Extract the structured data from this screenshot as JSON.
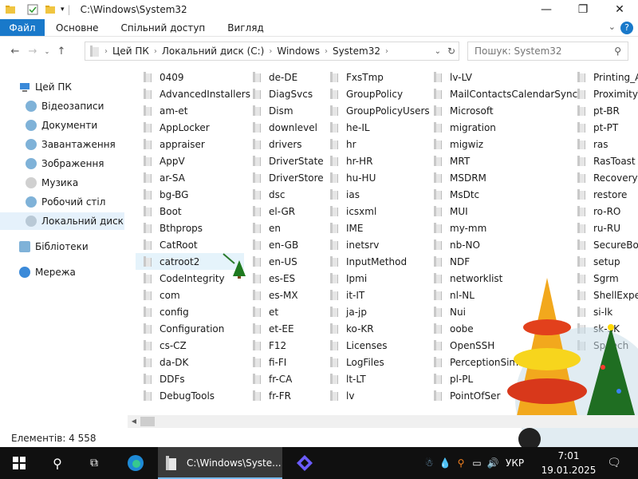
{
  "window": {
    "title": "C:\\Windows\\System32",
    "minimize_icon": "minimize-icon",
    "maximize_icon": "maximize-icon",
    "close_icon": "close-icon"
  },
  "ribbon": {
    "file": "Файл",
    "home": "Основне",
    "share": "Спільний доступ",
    "view": "Вигляд",
    "help": "?"
  },
  "address": {
    "crumbs": [
      "Цей ПК",
      "Локальний диск (C:)",
      "Windows",
      "System32"
    ]
  },
  "search": {
    "placeholder": "Пошук: System32"
  },
  "sidebar": {
    "this_pc": "Цей ПК",
    "videos": "Відеозаписи",
    "documents": "Документи",
    "downloads": "Завантаження",
    "pictures": "Зображення",
    "music": "Музика",
    "desktop": "Робочий стіл",
    "local_disk": "Локальний диск (C:)",
    "libraries": "Бібліотеки",
    "network": "Мережа"
  },
  "folders": {
    "col1": [
      "0409",
      "AdvancedInstallers",
      "am-et",
      "AppLocker",
      "appraiser",
      "AppV",
      "ar-SA",
      "bg-BG",
      "Boot",
      "Bthprops",
      "CatRoot",
      "catroot2",
      "CodeIntegrity",
      "com",
      "config",
      "Configuration",
      "cs-CZ",
      "da-DK",
      "DDFs",
      "DebugTools"
    ],
    "col2": [
      "de-DE",
      "DiagSvcs",
      "Dism",
      "downlevel",
      "drivers",
      "DriverState",
      "DriverStore",
      "dsc",
      "el-GR",
      "en",
      "en-GB",
      "en-US",
      "es-ES",
      "es-MX",
      "et",
      "et-EE",
      "F12",
      "fi-FI",
      "fr-CA",
      "fr-FR"
    ],
    "col3": [
      "FxsTmp",
      "GroupPolicy",
      "GroupPolicyUsers",
      "he-IL",
      "hr",
      "hr-HR",
      "hu-HU",
      "ias",
      "icsxml",
      "IME",
      "inetsrv",
      "InputMethod",
      "Ipmi",
      "it-IT",
      "ja-jp",
      "ko-KR",
      "Licenses",
      "LogFiles",
      "lt-LT",
      "lv"
    ],
    "col4": [
      "lv-LV",
      "MailContactsCalendarSync",
      "Microsoft",
      "migration",
      "migwiz",
      "MRT",
      "MSDRM",
      "MsDtc",
      "MUI",
      "my-mm",
      "nb-NO",
      "NDF",
      "networklist",
      "nl-NL",
      "Nui",
      "oobe",
      "OpenSSH",
      "PerceptionSim",
      "pl-PL",
      "PointOfSer"
    ],
    "col5": [
      "Printing_Ac",
      "ProximityTo",
      "pt-BR",
      "pt-PT",
      "ras",
      "RasToast",
      "Recovery",
      "restore",
      "ro-RO",
      "ru-RU",
      "SecureBoot",
      "setup",
      "Sgrm",
      "ShellExperie",
      "si-lk",
      "sk-SK",
      "Speech",
      "",
      "",
      ""
    ]
  },
  "status": {
    "count": "Елементів: 4 558"
  },
  "taskbar": {
    "explorer_label": "C:\\Windows\\Syste...",
    "language": "УКР",
    "time": "7:01",
    "date": "19.01.2025"
  },
  "colors": {
    "accent": "#1979ca",
    "selection": "#e5f1fb",
    "taskbar": "#101010"
  }
}
